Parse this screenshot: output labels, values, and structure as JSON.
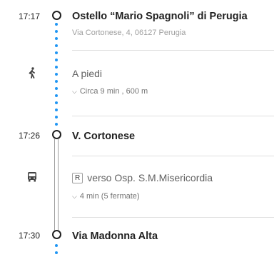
{
  "stops": [
    {
      "time": "17:17",
      "name": "Ostello “Mario Spagnoli” di Perugia",
      "address": "Via Cortonese, 4, 06127 Perugia"
    },
    {
      "time": "17:26",
      "name": "V. Cortonese"
    },
    {
      "time": "17:30",
      "name": "Via Madonna Alta"
    }
  ],
  "walk": {
    "label": "A piedi",
    "details": "Circa 9 min , 600 m",
    "icon": "walk-icon"
  },
  "bus": {
    "route": "R",
    "direction": "verso Osp. S.M.Misericordia",
    "details": "4 min (5 fermate)",
    "icon": "bus-icon"
  },
  "colors": {
    "walk_dots": "#2196f3",
    "text": "#212121",
    "secondary": "#757575"
  }
}
